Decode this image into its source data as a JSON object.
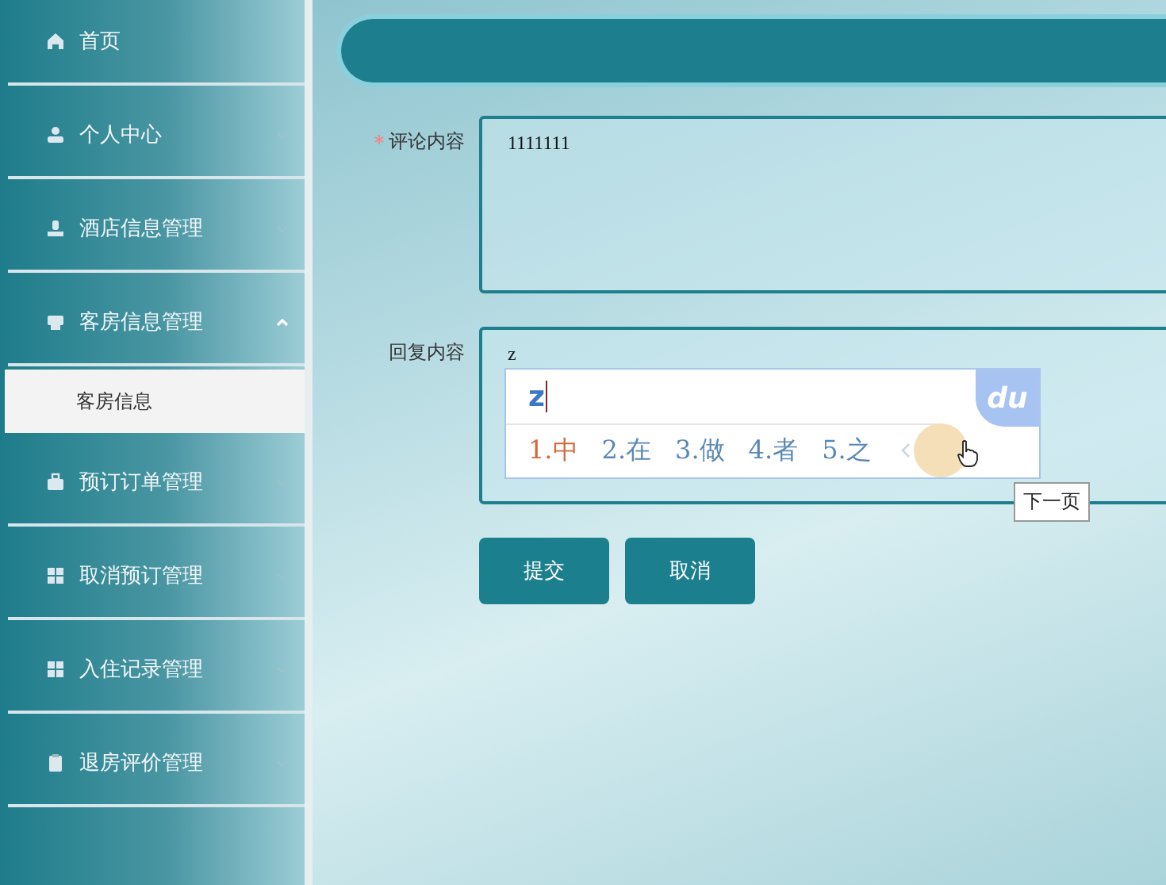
{
  "sidebar": {
    "items": [
      {
        "label": "首页"
      },
      {
        "label": "个人中心",
        "expanded": false
      },
      {
        "label": "酒店信息管理",
        "expanded": false
      },
      {
        "label": "客房信息管理",
        "expanded": true,
        "children": [
          {
            "label": "客房信息",
            "selected": true
          }
        ]
      },
      {
        "label": "预订订单管理",
        "expanded": false
      },
      {
        "label": "取消预订管理",
        "expanded": false
      },
      {
        "label": "入住记录管理",
        "expanded": false
      },
      {
        "label": "退房评价管理",
        "expanded": false
      }
    ]
  },
  "form": {
    "fields": [
      {
        "label": "评论内容",
        "required": true,
        "value": "1111111"
      },
      {
        "label": "回复内容",
        "required": false,
        "value": "z"
      }
    ],
    "buttons": [
      "提交",
      "取消"
    ]
  },
  "ime": {
    "input": "z",
    "logo": "du",
    "candidates": [
      {
        "label": "1.中",
        "selected": true
      },
      {
        "label": "2.在",
        "selected": false
      },
      {
        "label": "3.做",
        "selected": false
      },
      {
        "label": "4.者",
        "selected": false
      },
      {
        "label": "5.之",
        "selected": false
      }
    ],
    "tooltip": "下一页"
  }
}
